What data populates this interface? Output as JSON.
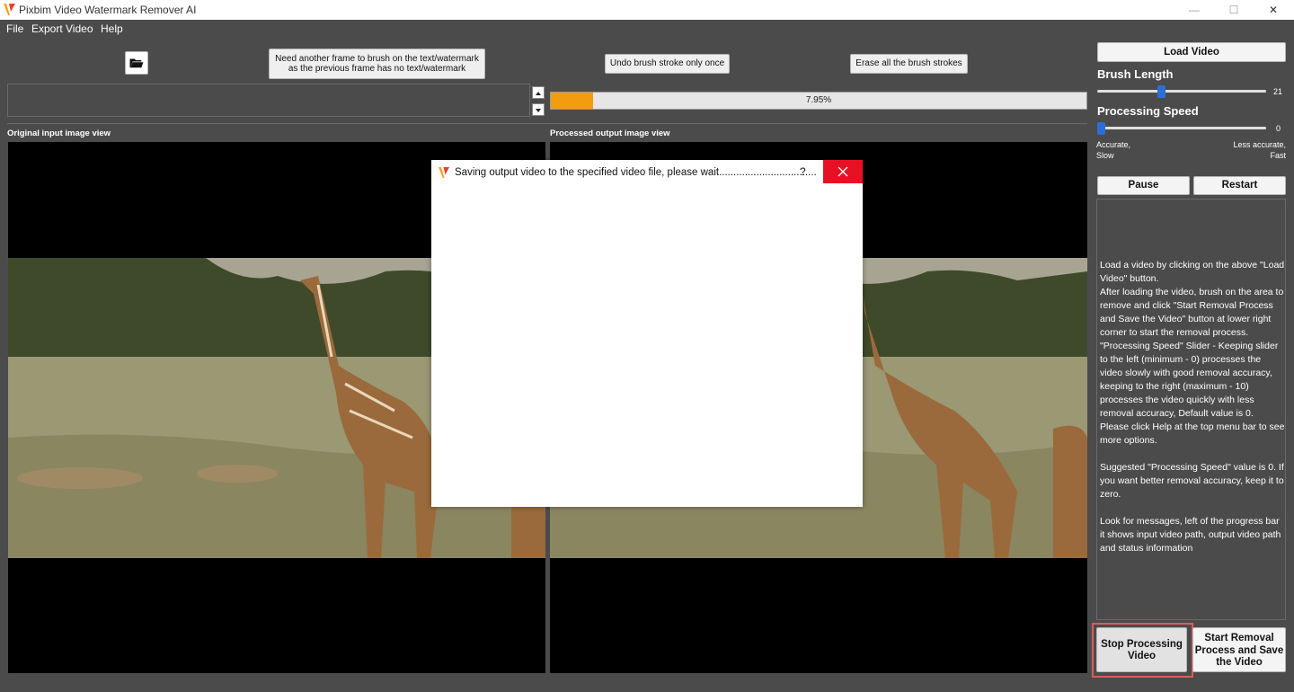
{
  "window": {
    "title": "Pixbim Video Watermark Remover AI",
    "controls": {
      "minimize": "—",
      "maximize": "☐",
      "close": "✕"
    }
  },
  "menu": [
    "File",
    "Export Video",
    "Help"
  ],
  "toolbar": {
    "another_frame_line1": "Need another frame to brush on the text/watermark",
    "another_frame_line2": "as the previous frame has no text/watermark",
    "undo_label": "Undo brush stroke only once",
    "erase_label": "Erase all the brush strokes"
  },
  "progress": {
    "value": 0.0795,
    "text": "7.95%",
    "color": "#f39c0e"
  },
  "views": {
    "original_label": "Original input image view",
    "processed_label": "Processed output image view"
  },
  "right_panel": {
    "load_video": "Load Video",
    "brush_length_label": "Brush Length",
    "brush_length_value": "21",
    "brush_length_fraction": 0.38,
    "processing_speed_label": "Processing Speed",
    "processing_speed_value": "0",
    "processing_speed_fraction": 0.0,
    "left_note": "Accurate,\nSlow",
    "right_note": "Less accurate,\nFast",
    "pause": "Pause",
    "restart": "Restart",
    "help_text": "Load a video by clicking on the above \"Load Video\" button.\nAfter loading the video, brush on the area to remove and click \"Start Removal Process and Save the Video\" button at lower right corner to start the removal process.\n\"Processing Speed\" Slider - Keeping slider to the left (minimum - 0) processes the video slowly with good removal accuracy, keeping to the right (maximum - 10) processes the video quickly with less removal accuracy, Default value is 0.\nPlease click Help at the top menu bar to see more options.\n\nSuggested \"Processing Speed\" value is 0. If you want better removal accuracy, keep it to zero.\n\nLook for messages, left of the progress bar it shows input video path, output video path and status information",
    "stop_processing": "Stop Processing Video",
    "start_removal": "Start Removal Process and Save the Video"
  },
  "dialog": {
    "title": "Saving output video to the specified video file, please wait..................................",
    "help": "?",
    "close": "✕"
  },
  "colors": {
    "accent_blue": "#2b6fd6",
    "close_red": "#e81123",
    "highlight": "#e05a5a"
  }
}
